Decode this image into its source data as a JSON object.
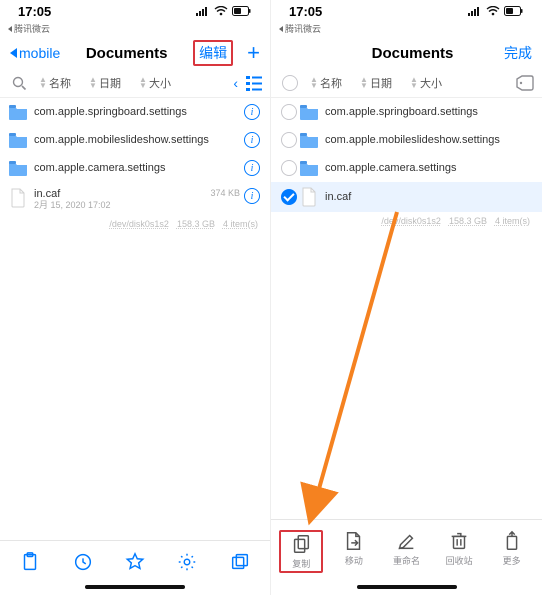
{
  "status": {
    "time": "17:05"
  },
  "left": {
    "back_app": "腾讯微云",
    "nav_back": "mobile",
    "nav_title": "Documents",
    "nav_edit": "编辑",
    "sort": {
      "name": "名称",
      "date": "日期",
      "size": "大小"
    },
    "rows": [
      {
        "name": "com.apple.springboard.settings"
      },
      {
        "name": "com.apple.mobileslideshow.settings"
      },
      {
        "name": "com.apple.camera.settings"
      }
    ],
    "file": {
      "name": "in.caf",
      "size": "374 KB",
      "date": "2月 15, 2020 17:02"
    },
    "footer": {
      "disk": "/dev/disk0s1s2",
      "space": "158.3 GB",
      "items": "4 item(s)"
    }
  },
  "right": {
    "back_app": "腾讯微云",
    "nav_title": "Documents",
    "nav_done": "完成",
    "sort": {
      "name": "名称",
      "date": "日期",
      "size": "大小"
    },
    "rows": [
      {
        "name": "com.apple.springboard.settings"
      },
      {
        "name": "com.apple.mobileslideshow.settings"
      },
      {
        "name": "com.apple.camera.settings"
      }
    ],
    "file": {
      "name": "in.caf"
    },
    "footer": {
      "disk": "/dev/disk0s1s2",
      "space": "158.3 GB",
      "items": "4 item(s)"
    },
    "toolbar": {
      "copy": "复制",
      "move": "移动",
      "rename": "重命名",
      "trash": "回收站",
      "more": "更多"
    }
  }
}
